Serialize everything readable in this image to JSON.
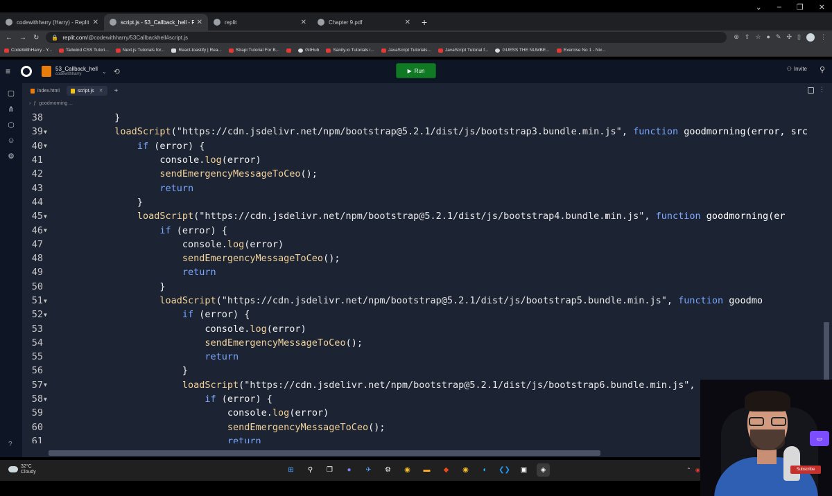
{
  "browser": {
    "tabs": [
      {
        "title": "codewithharry (Harry) - Replit",
        "active": false
      },
      {
        "title": "script.js - 53_Callback_hell - Repl",
        "active": true
      },
      {
        "title": "replit",
        "active": false
      },
      {
        "title": "Chapter 9.pdf",
        "active": false
      }
    ],
    "url_host": "replit.com",
    "url_path": "/@codewithharry/53Callbackhell#script.js",
    "bookmarks": [
      "CodeWithHarry - Y...",
      "Tailwind CSS Tutori...",
      "Next.js Tutorials for...",
      "React-toastify | Rea...",
      "Strapi Tutorial For B...",
      "GitHub",
      "Sanity.io Tutorials i...",
      "JavaScript Tutorials...",
      "JavaScript Tutorial f...",
      "GUESS THE NUMBE...",
      "Exercise No 1 - Nix..."
    ]
  },
  "replit": {
    "repl_name": "53_Callback_hell",
    "owner": "codewithharry",
    "run_label": "Run",
    "invite_label": "Invite",
    "file_tabs": [
      "index.html",
      "script.js"
    ],
    "breadcrumb": "goodmorning ..."
  },
  "code_lines": [
    {
      "n": "38",
      "fold": false,
      "indent": 10,
      "tokens": [
        {
          "t": "}",
          "c": "txt"
        }
      ]
    },
    {
      "n": "39",
      "fold": true,
      "indent": 10,
      "tokens": [
        {
          "t": "loadScript",
          "c": "tk-fn"
        },
        {
          "t": "(",
          "c": "txt"
        },
        {
          "t": "\"https://cdn.jsdelivr.net/npm/bootstrap@5.2.1/dist/js/bootstrap3.bundle.min.js\"",
          "c": "tk-str"
        },
        {
          "t": ", ",
          "c": "txt"
        },
        {
          "t": "function",
          "c": "tk-kw"
        },
        {
          "t": " goodmorning(error, src",
          "c": "tk-name"
        }
      ]
    },
    {
      "n": "40",
      "fold": true,
      "indent": 14,
      "tokens": [
        {
          "t": "if",
          "c": "tk-kw"
        },
        {
          "t": " (error) {",
          "c": "txt"
        }
      ]
    },
    {
      "n": "41",
      "fold": false,
      "indent": 18,
      "tokens": [
        {
          "t": "console.",
          "c": "txt"
        },
        {
          "t": "log",
          "c": "tk-fn"
        },
        {
          "t": "(error)",
          "c": "txt"
        }
      ]
    },
    {
      "n": "42",
      "fold": false,
      "indent": 18,
      "tokens": [
        {
          "t": "sendEmergencyMessageToCeo",
          "c": "tk-fn"
        },
        {
          "t": "();",
          "c": "txt"
        }
      ]
    },
    {
      "n": "43",
      "fold": false,
      "indent": 18,
      "tokens": [
        {
          "t": "return",
          "c": "tk-kw"
        }
      ]
    },
    {
      "n": "44",
      "fold": false,
      "indent": 14,
      "tokens": [
        {
          "t": "}",
          "c": "txt"
        }
      ]
    },
    {
      "n": "45",
      "fold": true,
      "indent": 14,
      "tokens": [
        {
          "t": "loadScript",
          "c": "tk-fn"
        },
        {
          "t": "(",
          "c": "txt"
        },
        {
          "t": "\"https://cdn.jsdelivr.net/npm/bootstrap@5.2.1/dist/js/bootstrap4.bundle.min.js\"",
          "c": "tk-str"
        },
        {
          "t": ", ",
          "c": "txt"
        },
        {
          "t": "function",
          "c": "tk-kw"
        },
        {
          "t": " goodmorning(er",
          "c": "tk-name"
        }
      ]
    },
    {
      "n": "46",
      "fold": true,
      "indent": 18,
      "tokens": [
        {
          "t": "if",
          "c": "tk-kw"
        },
        {
          "t": " (error) {",
          "c": "txt"
        }
      ]
    },
    {
      "n": "47",
      "fold": false,
      "indent": 22,
      "tokens": [
        {
          "t": "console.",
          "c": "txt"
        },
        {
          "t": "log",
          "c": "tk-fn"
        },
        {
          "t": "(error)",
          "c": "txt"
        }
      ]
    },
    {
      "n": "48",
      "fold": false,
      "indent": 22,
      "tokens": [
        {
          "t": "sendEmergencyMessageToCeo",
          "c": "tk-fn"
        },
        {
          "t": "();",
          "c": "txt"
        }
      ]
    },
    {
      "n": "49",
      "fold": false,
      "indent": 22,
      "tokens": [
        {
          "t": "return",
          "c": "tk-kw"
        }
      ]
    },
    {
      "n": "50",
      "fold": false,
      "indent": 18,
      "tokens": [
        {
          "t": "}",
          "c": "txt"
        }
      ]
    },
    {
      "n": "51",
      "fold": true,
      "indent": 18,
      "tokens": [
        {
          "t": "loadScript",
          "c": "tk-fn"
        },
        {
          "t": "(",
          "c": "txt"
        },
        {
          "t": "\"https://cdn.jsdelivr.net/npm/bootstrap@5.2.1/dist/js/bootstrap5.bundle.min.js\"",
          "c": "tk-str"
        },
        {
          "t": ", ",
          "c": "txt"
        },
        {
          "t": "function",
          "c": "tk-kw"
        },
        {
          "t": " goodmo",
          "c": "tk-name"
        }
      ]
    },
    {
      "n": "52",
      "fold": true,
      "indent": 22,
      "tokens": [
        {
          "t": "if",
          "c": "tk-kw"
        },
        {
          "t": " (error) {",
          "c": "txt"
        }
      ]
    },
    {
      "n": "53",
      "fold": false,
      "indent": 26,
      "tokens": [
        {
          "t": "console.",
          "c": "txt"
        },
        {
          "t": "log",
          "c": "tk-fn"
        },
        {
          "t": "(error)",
          "c": "txt"
        }
      ]
    },
    {
      "n": "54",
      "fold": false,
      "indent": 26,
      "tokens": [
        {
          "t": "sendEmergencyMessageToCeo",
          "c": "tk-fn"
        },
        {
          "t": "();",
          "c": "txt"
        }
      ]
    },
    {
      "n": "55",
      "fold": false,
      "indent": 26,
      "tokens": [
        {
          "t": "return",
          "c": "tk-kw"
        }
      ]
    },
    {
      "n": "56",
      "fold": false,
      "indent": 22,
      "tokens": [
        {
          "t": "}",
          "c": "txt"
        }
      ]
    },
    {
      "n": "57",
      "fold": true,
      "indent": 22,
      "tokens": [
        {
          "t": "loadScript",
          "c": "tk-fn"
        },
        {
          "t": "(",
          "c": "txt"
        },
        {
          "t": "\"https://cdn.jsdelivr.net/npm/bootstrap@5.2.1/dist/js/bootstrap6.bundle.min.js\"",
          "c": "tk-str"
        },
        {
          "t": ", ",
          "c": "txt"
        },
        {
          "t": "functio",
          "c": "tk-kw"
        }
      ]
    },
    {
      "n": "58",
      "fold": true,
      "indent": 26,
      "tokens": [
        {
          "t": "if",
          "c": "tk-kw"
        },
        {
          "t": " (error) {",
          "c": "txt"
        }
      ]
    },
    {
      "n": "59",
      "fold": false,
      "indent": 30,
      "tokens": [
        {
          "t": "console.",
          "c": "txt"
        },
        {
          "t": "log",
          "c": "tk-fn"
        },
        {
          "t": "(error)",
          "c": "txt"
        }
      ]
    },
    {
      "n": "60",
      "fold": false,
      "indent": 30,
      "tokens": [
        {
          "t": "sendEmergencyMessageToCeo",
          "c": "tk-fn"
        },
        {
          "t": "();",
          "c": "txt"
        }
      ]
    },
    {
      "n": "61",
      "fold": false,
      "indent": 30,
      "tokens": [
        {
          "t": "return",
          "c": "tk-kw"
        }
      ]
    }
  ],
  "taskbar": {
    "temperature": "32°C",
    "weather": "Cloudy"
  },
  "overlay": {
    "subscribe_label": "Subscribe"
  }
}
